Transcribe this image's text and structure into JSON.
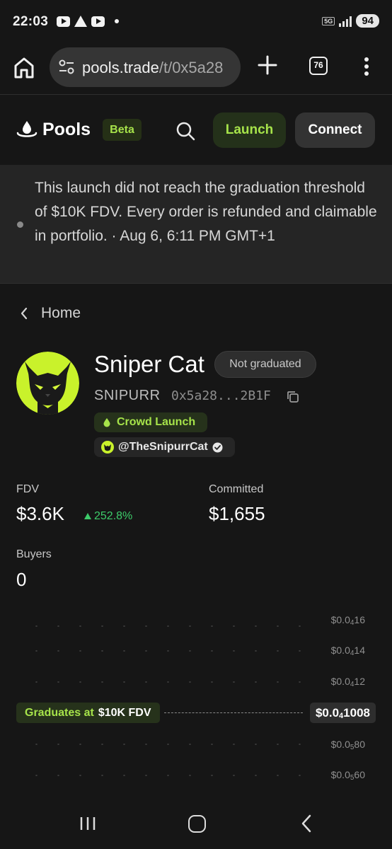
{
  "status_bar": {
    "time": "22:03",
    "notification_icons": [
      "youtube-icon",
      "warning-icon",
      "youtube-icon",
      "dot-icon"
    ],
    "network": "5G",
    "battery": "94"
  },
  "browser": {
    "url_main": "pools.trade",
    "url_path": "/t/0x5a28",
    "tab_count": "76"
  },
  "header": {
    "logo": "Pools",
    "beta": "Beta",
    "launch": "Launch",
    "connect": "Connect"
  },
  "banner": {
    "text": "This launch did not reach the graduation threshold of $10K FDV. Every order is refunded and claimable in portfolio. · Aug 6, 6:11 PM GMT+1"
  },
  "breadcrumb": {
    "label": "Home"
  },
  "token": {
    "name": "Sniper Cat",
    "status": "Not graduated",
    "ticker": "SNIPURR",
    "address": "0x5a28...2B1F",
    "launch_type": "Crowd Launch",
    "twitter": "@TheSnipurrCat"
  },
  "stats": {
    "fdv_label": "FDV",
    "fdv_value": "$3.6K",
    "fdv_change": "252.8%",
    "committed_label": "Committed",
    "committed_value": "$1,655",
    "buyers_label": "Buyers",
    "buyers_value": "0"
  },
  "chart": {
    "y_ticks": [
      {
        "prefix": "$0.0",
        "sub": "4",
        "suffix": "16"
      },
      {
        "prefix": "$0.0",
        "sub": "4",
        "suffix": "14"
      },
      {
        "prefix": "$0.0",
        "sub": "4",
        "suffix": "12"
      },
      {
        "prefix": "$0.0",
        "sub": "5",
        "suffix": "80"
      },
      {
        "prefix": "$0.0",
        "sub": "5",
        "suffix": "60"
      }
    ],
    "graduates_label": "Graduates at",
    "graduates_value": "$10K FDV",
    "graduation_price": {
      "prefix": "$0.0",
      "sub": "4",
      "suffix": "1008"
    }
  },
  "colors": {
    "accent_green": "#a6e34a",
    "positive_green": "#3dcb6a",
    "background": "#161616"
  }
}
